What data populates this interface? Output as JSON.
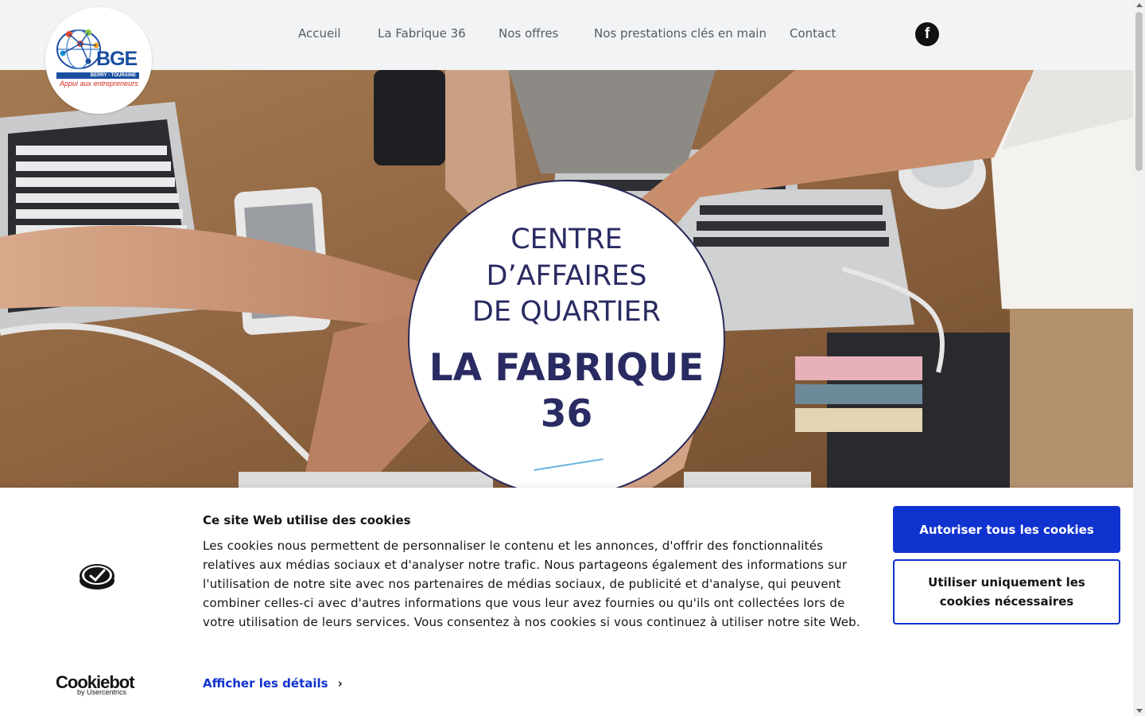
{
  "header": {
    "logo": {
      "brand": "BGE",
      "band": "BERRY - TOURAINE",
      "tagline": "Appui aux entrepreneurs"
    },
    "nav": [
      {
        "label": "Accueil"
      },
      {
        "label": "La Fabrique 36"
      },
      {
        "label": "Nos offres"
      },
      {
        "label": "Nos prestations clés en main"
      },
      {
        "label": "Contact"
      }
    ],
    "social": {
      "icon": "facebook-icon",
      "glyph": "f"
    }
  },
  "hero": {
    "line1": "CENTRE",
    "line2": "D’AFFAIRES",
    "line3": "DE QUARTIER",
    "title1": "LA FABRIQUE",
    "title2": "36"
  },
  "cookie_banner": {
    "brand": "Cookiebot",
    "brand_by": "by Usercentrics",
    "title": "Ce site Web utilise des cookies",
    "text": "Les cookies nous permettent de personnaliser le contenu et les annonces, d'offrir des fonctionnalités relatives aux médias sociaux et d'analyser notre trafic. Nous partageons également des informations sur l'utilisation de notre site avec nos partenaires de médias sociaux, de publicité et d'analyse, qui peuvent combiner celles-ci avec d'autres informations que vous leur avez fournies ou qu'ils ont collectées lors de votre utilisation de leurs services. Vous consentez à nos cookies si vous continuez à utiliser notre site Web.",
    "details_label": "Afficher les détails",
    "allow_all_label": "Autoriser tous les cookies",
    "necessary_label": "Utiliser uniquement les cookies nécessaires"
  },
  "colors": {
    "accent": "#1032cf",
    "brand_blue": "#1a4fa0",
    "badge_text": "#2a2b62",
    "header_bg": "#f2f3f4"
  }
}
